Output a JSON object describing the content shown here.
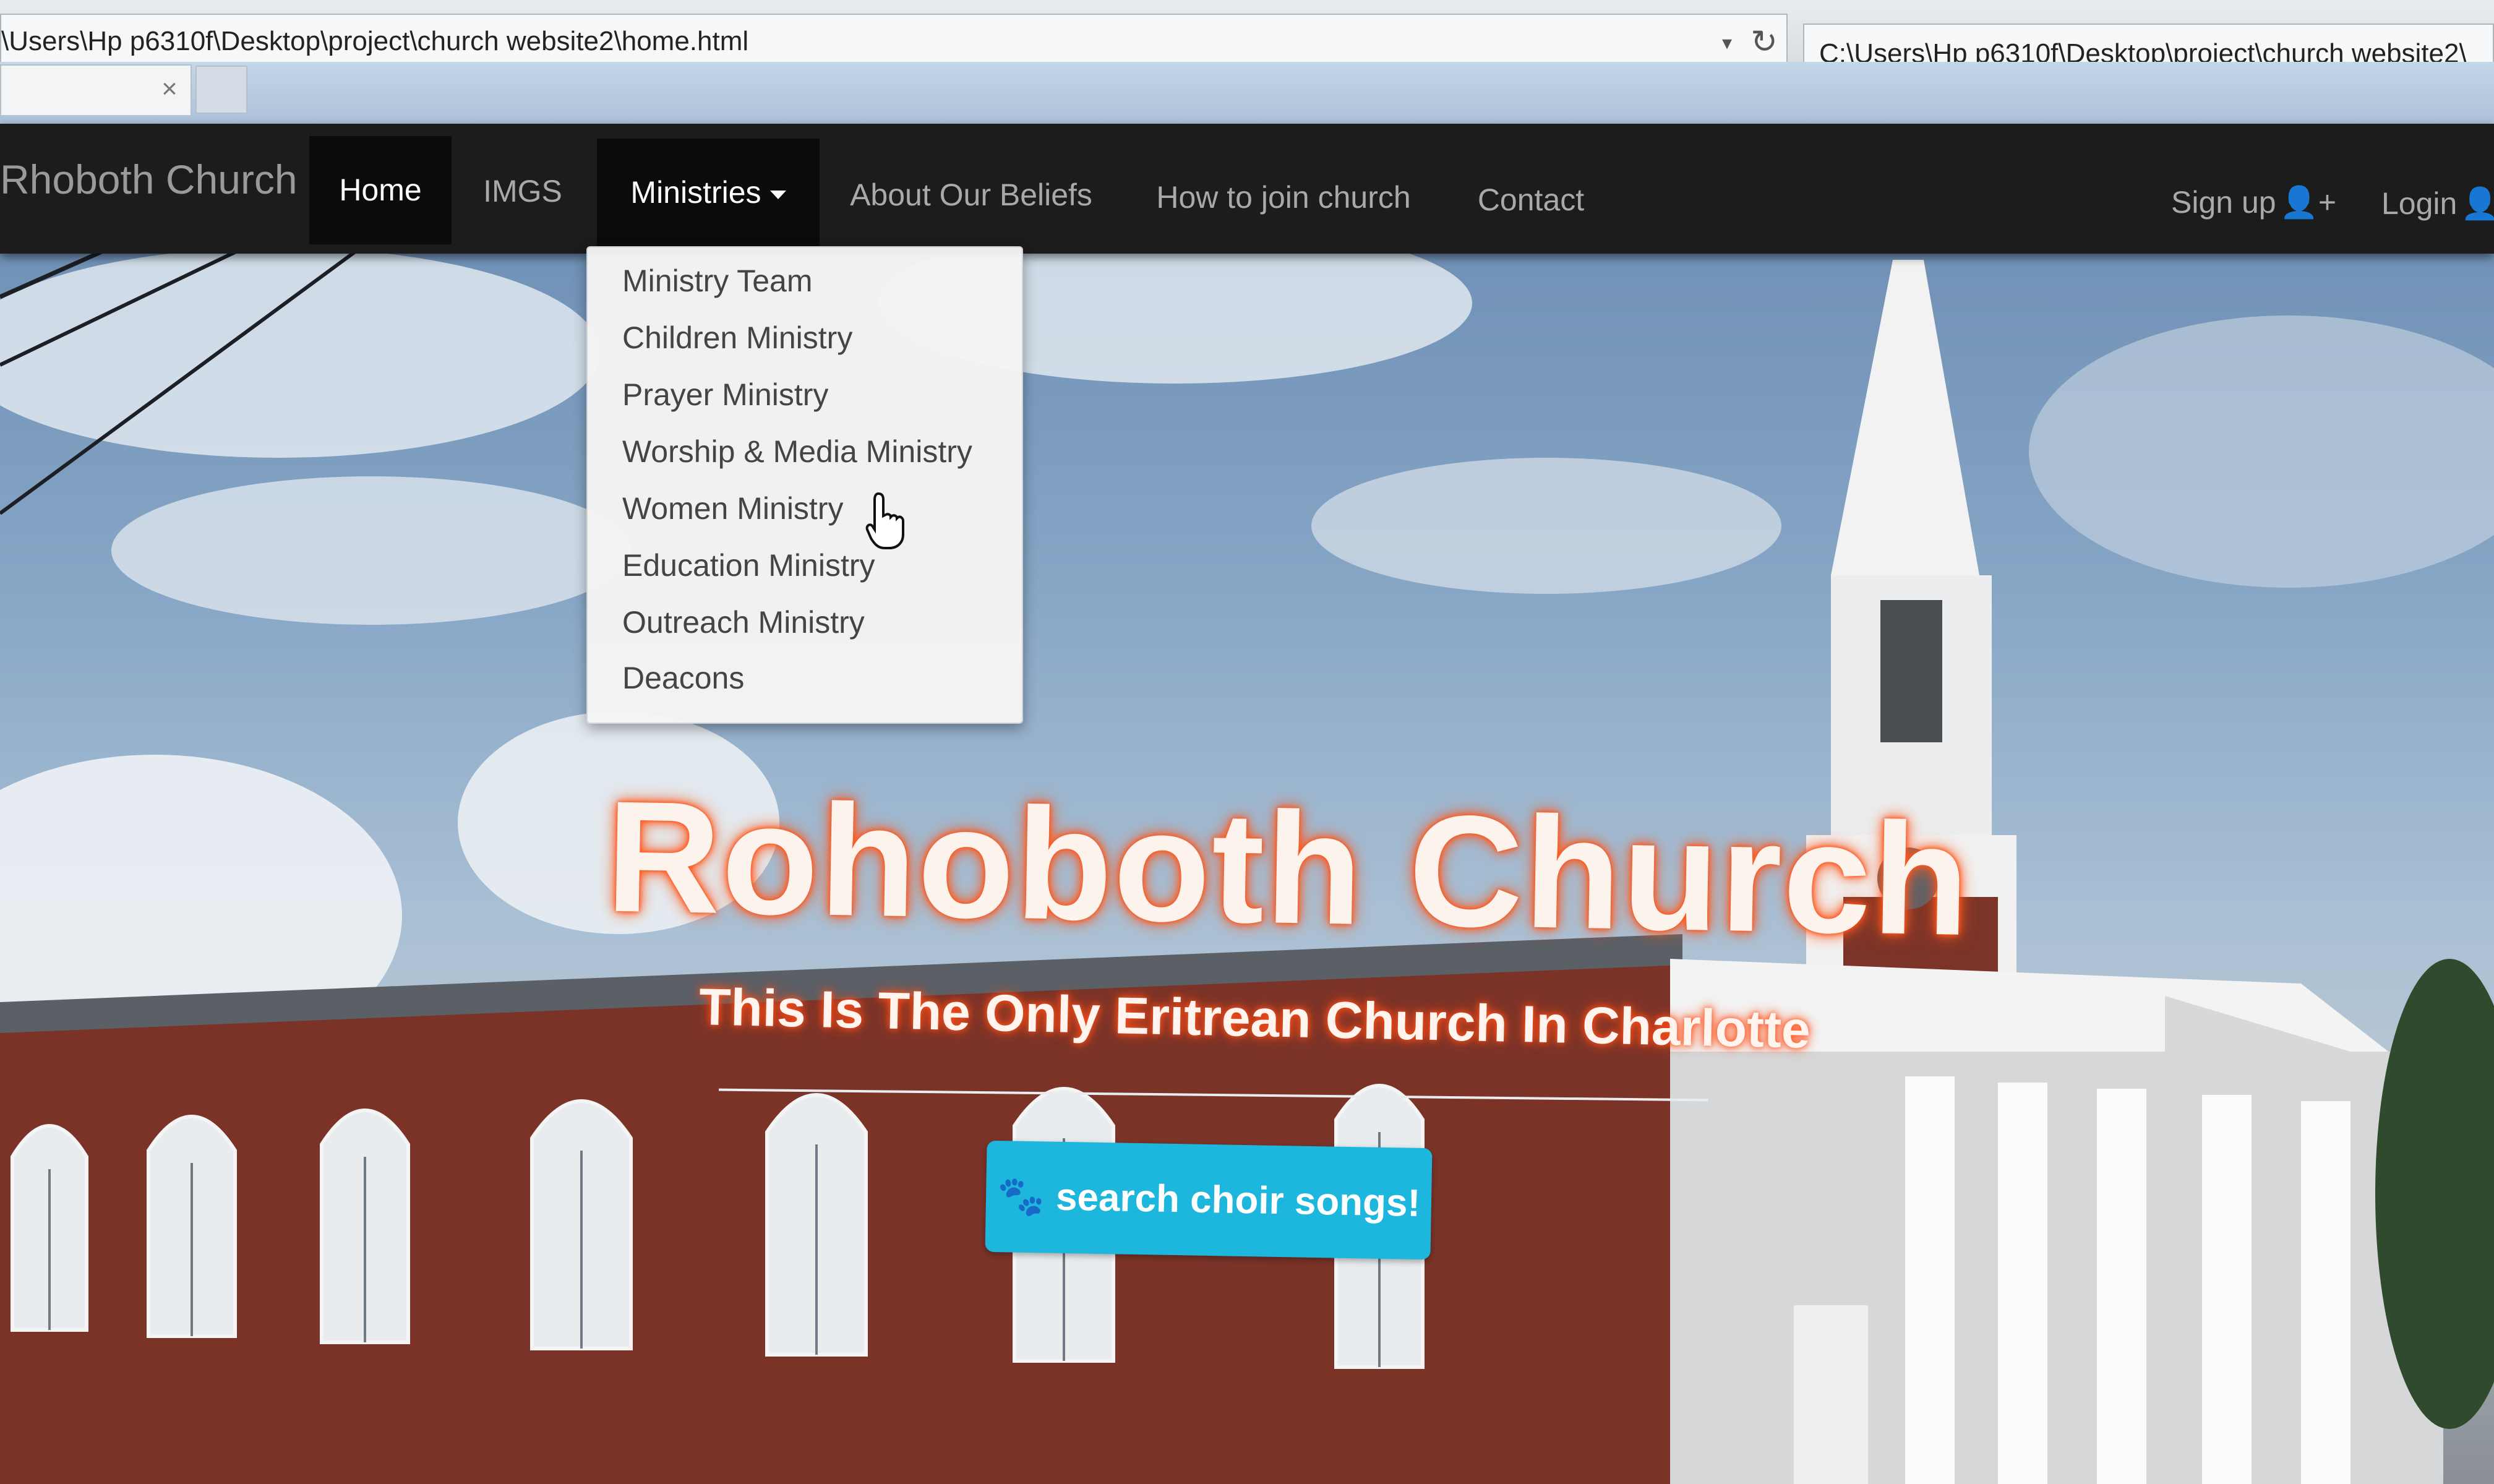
{
  "browser": {
    "address_left": "\\Users\\Hp p6310f\\Desktop\\project\\church website2\\home.html",
    "address_right": "C:\\Users\\Hp p6310f\\Desktop\\project\\church website2\\",
    "dropdown_glyph": "▾",
    "refresh_glyph": "↻",
    "tab_close_glyph": "×"
  },
  "navbar": {
    "brand": "Rhoboth Church",
    "items": [
      {
        "label": "Home",
        "state": "active"
      },
      {
        "label": "IMGS"
      },
      {
        "label": "Ministries",
        "state": "open"
      },
      {
        "label": "About Our Beliefs"
      },
      {
        "label": "How to join church"
      },
      {
        "label": "Contact"
      }
    ],
    "signup": {
      "label": "Sign up",
      "icon": "user-plus-icon",
      "glyph": "👤+"
    },
    "login": {
      "label": "Login",
      "icon": "user-icon",
      "glyph": "👤"
    }
  },
  "ministries_menu": {
    "items": [
      "Ministry Team",
      "Children Ministry",
      "Prayer Ministry",
      "Worship & Media Ministry",
      "Women Ministry",
      "Education Ministry",
      "Outreach Ministry",
      "Deacons"
    ]
  },
  "hero": {
    "title": "Rohoboth Church",
    "subtitle": "This Is The Only Eritrean Church In Charlotte",
    "cta_label": "search choir songs!",
    "cta_icon": "paw-icon",
    "cta_glyph": "🐾"
  },
  "colors": {
    "navbar_bg": "#1c1c1c",
    "cta_bg": "#1db6dc",
    "title_glow": "#ff5a1f"
  }
}
